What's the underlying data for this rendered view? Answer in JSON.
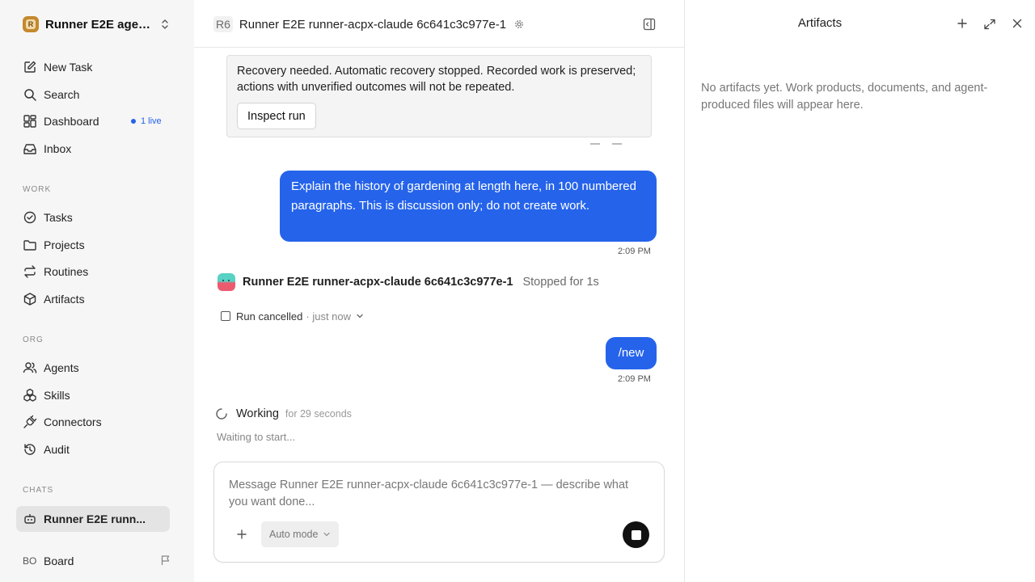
{
  "workspace": {
    "name": "Runner E2E agen...",
    "logo_letter": "R"
  },
  "nav": {
    "new_task": "New Task",
    "search": "Search",
    "dashboard": "Dashboard",
    "dashboard_badge": "1 live",
    "inbox": "Inbox"
  },
  "sections": {
    "work": "WORK",
    "org": "ORG",
    "chats": "CHATS"
  },
  "work_items": {
    "tasks": "Tasks",
    "projects": "Projects",
    "routines": "Routines",
    "artifacts": "Artifacts"
  },
  "org_items": {
    "agents": "Agents",
    "skills": "Skills",
    "connectors": "Connectors",
    "audit": "Audit"
  },
  "chats": {
    "active_chat": "Runner E2E runn..."
  },
  "board": {
    "initials": "BO",
    "label": "Board"
  },
  "header": {
    "badge": "R6",
    "title": "Runner E2E runner-acpx-claude 6c641c3c977e-1"
  },
  "recovery": {
    "message": "Recovery needed. Automatic recovery stopped. Recorded work is preserved; actions with unverified outcomes will not be repeated.",
    "button": "Inspect run"
  },
  "messages": [
    {
      "text": "Explain the history of gardening at length here, in 100 numbered paragraphs. This is discussion only; do not create work.",
      "time": "2:09 PM"
    },
    {
      "text": "/new",
      "time": "2:09 PM"
    }
  ],
  "agent": {
    "name": "Runner E2E runner-acpx-claude 6c641c3c977e-1",
    "status": "Stopped for 1s"
  },
  "run": {
    "label": "Run cancelled",
    "when": "· just now"
  },
  "working": {
    "label": "Working",
    "duration": "for 29 seconds",
    "waiting": "Waiting to start..."
  },
  "composer": {
    "placeholder": "Message Runner E2E runner-acpx-claude 6c641c3c977e-1 — describe what you want done...",
    "mode": "Auto mode"
  },
  "artifacts_panel": {
    "title": "Artifacts",
    "empty": "No artifacts yet. Work products, documents, and agent-produced files will appear here."
  },
  "colors": {
    "accent": "#2563eb",
    "sidebar_bg": "#f6f6f6",
    "stop_button": "#111111"
  }
}
